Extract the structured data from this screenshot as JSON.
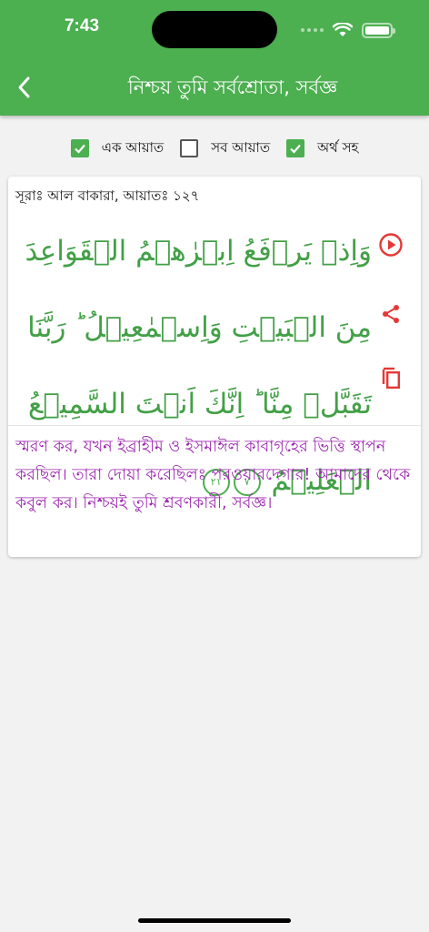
{
  "status_bar": {
    "time": "7:43"
  },
  "header": {
    "title": "নিশ্চয় তুমি সর্বশ্রোতা, সর্বজ্ঞ"
  },
  "options": [
    {
      "label": "এক আয়াত",
      "checked": true
    },
    {
      "label": "সব আয়াত",
      "checked": false
    },
    {
      "label": "অর্থ সহ",
      "checked": true
    }
  ],
  "verse": {
    "reference": "সূরাঃ আল বাকারা, আয়াতঃ ১২৭",
    "arabic": "وَاِذۡ یَرۡفَعُ اِبۡرٰهٖمُ الۡقَوَاعِدَ مِنَ الۡبَیۡتِ وَاِسۡمٰعِیۡلُ ؕ رَبَّنَا تَقَبَّلۡ مِنَّا ؕ اِنَّكَ اَنۡتَ السَّمِیۡعُ الۡعَلِیۡمُ",
    "ayah_marker_1": "٧",
    "ayah_marker_2": "٢١",
    "translation": "স্মরণ কর, যখন ইব্রাহীম ও ইসমাঈল কাবাগৃহের ভিত্তি স্থাপন করছিল। তারা দোয়া করেছিলঃ পরওয়ারদেগার! আমাদের থেকে কবুল কর। নিশ্চয়ই তুমি শ্রবণকারী, সর্বজ্ঞ।"
  },
  "actions": {
    "play": "play-icon",
    "share": "share-icon",
    "copy": "copy-icon"
  },
  "colors": {
    "primary": "#4caf50",
    "arabic": "#43a047",
    "translation": "#9c27b0",
    "action": "#e53935"
  }
}
